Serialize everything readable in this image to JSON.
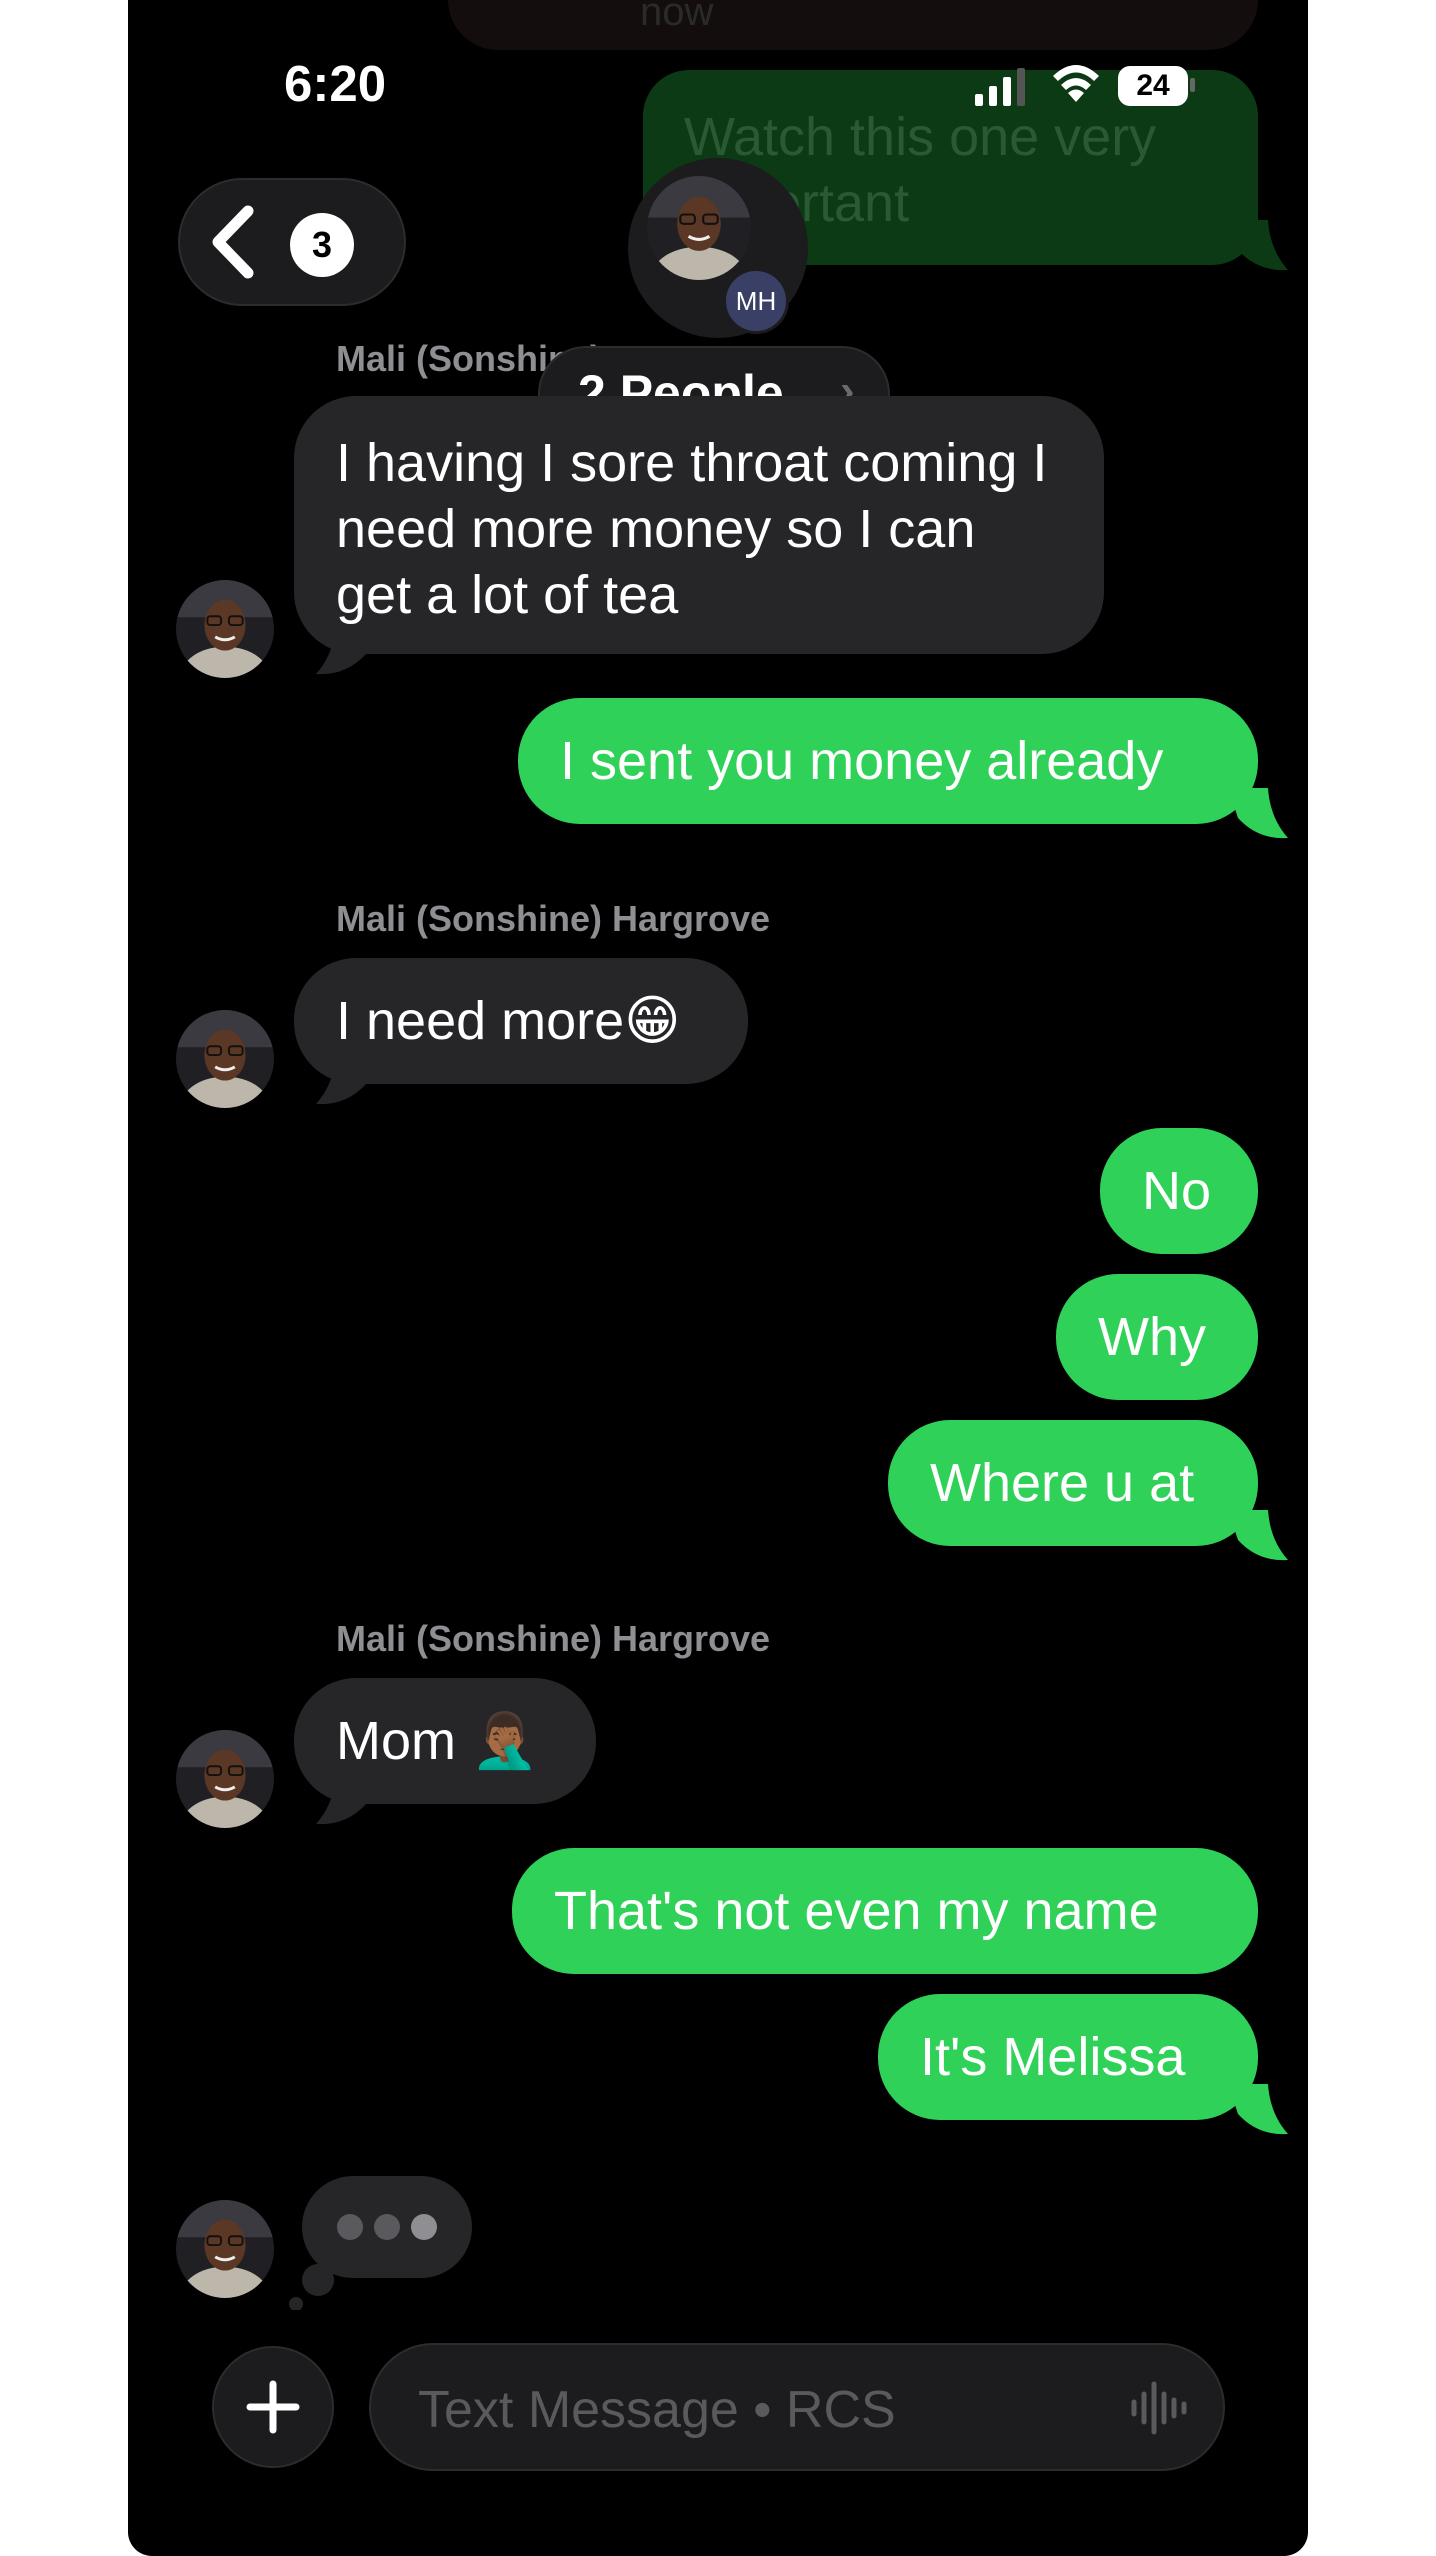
{
  "status_bar": {
    "time": "6:20",
    "battery": "24"
  },
  "faded_messages": {
    "top_partial": "now",
    "green_partial": "Watch this one very important"
  },
  "header": {
    "back_badge": "3",
    "group_initials": "MH",
    "group_title": "2 People",
    "chevron": "›"
  },
  "messages": [
    {
      "sender": "Mali (Sonshine) Hargrove",
      "text": "I having I sore throat coming I need more money so I can get a lot of tea",
      "direction": "incoming"
    },
    {
      "text": "I sent you money already",
      "direction": "outgoing"
    },
    {
      "sender": "Mali (Sonshine) Hargrove",
      "text": "I need more😁",
      "direction": "incoming"
    },
    {
      "text": "No",
      "direction": "outgoing"
    },
    {
      "text": "Why",
      "direction": "outgoing"
    },
    {
      "text": "Where u at",
      "direction": "outgoing"
    },
    {
      "sender": "Mali (Sonshine) Hargrove",
      "text": "Mom 🤦🏾‍♂️",
      "direction": "incoming"
    },
    {
      "text": "That's not even my name",
      "direction": "outgoing"
    },
    {
      "text": "It's Melissa",
      "direction": "outgoing"
    }
  ],
  "typing_indicator": "typing-dots",
  "input_bar": {
    "placeholder": "Text Message • RCS",
    "add_icon": "plus-icon",
    "voice_icon": "waveform-icon"
  },
  "colors": {
    "background": "#000000",
    "incoming": "#262629",
    "outgoing": "#30d158",
    "secondary_text": "#8e8e93"
  }
}
